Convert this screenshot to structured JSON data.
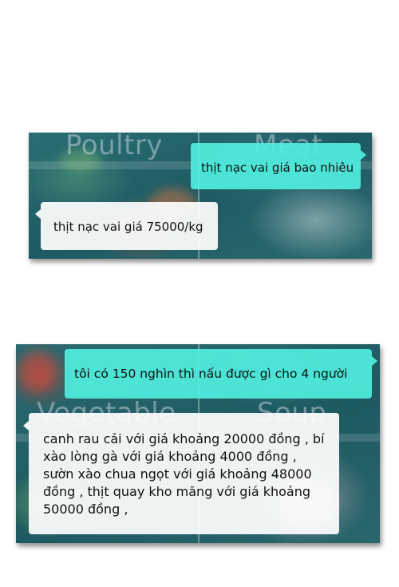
{
  "colors": {
    "panel_bg": "#1e5f66",
    "user_bubble": "#50eede",
    "bot_bubble": "#ffffff"
  },
  "panel1": {
    "categories": [
      "Poultry",
      "Meat"
    ],
    "user_message": "thịt nạc vai giá bao nhiêu",
    "bot_message": "thịt nạc vai giá 75000/kg"
  },
  "panel2": {
    "categories": [
      "Vegetable",
      "Soup"
    ],
    "user_message": "tôi có 150 nghìn thì nấu được gì cho 4 người",
    "bot_message": "canh rau cải với giá khoảng 20000 đồng , bí xào lòng gà với giá khoảng 4000 đồng , sườn xào chua ngọt với giá khoảng 48000 đồng , thịt quay kho măng với giá khoảng 50000 đồng ,"
  }
}
